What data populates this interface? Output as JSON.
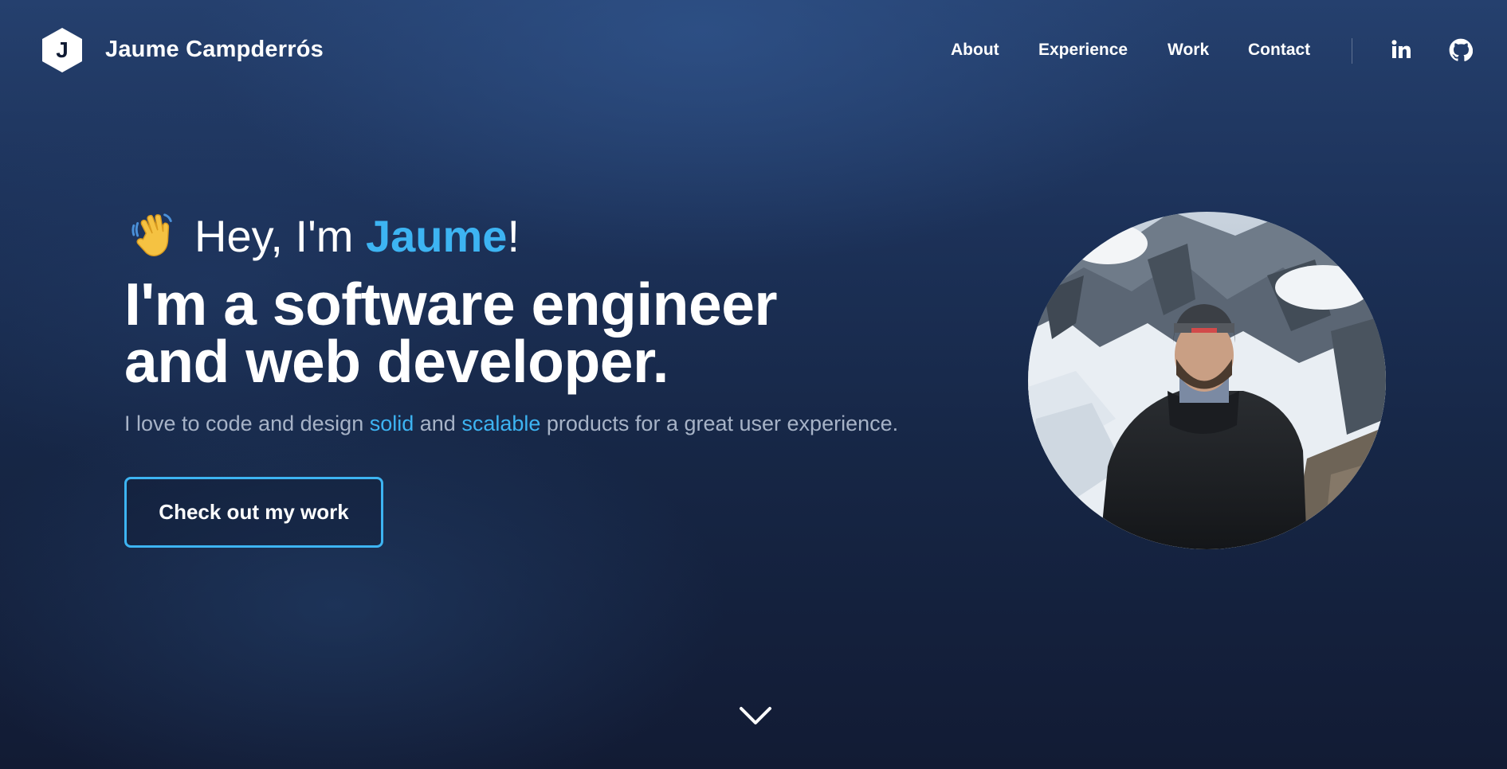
{
  "header": {
    "logo_letter": "J",
    "brand_name": "Jaume Campderrós",
    "nav": [
      {
        "label": "About"
      },
      {
        "label": "Experience"
      },
      {
        "label": "Work"
      },
      {
        "label": "Contact"
      }
    ],
    "social": [
      {
        "icon": "linkedin-icon"
      },
      {
        "icon": "github-icon"
      }
    ]
  },
  "hero": {
    "greeting_prefix": "Hey, I'm ",
    "greeting_name": "Jaume",
    "greeting_suffix": "!",
    "wave_icon": "waving-hand-icon",
    "headline_1_prefix": "I'm a ",
    "headline_1_bold": "software engineer",
    "headline_2_prefix": "and ",
    "headline_2_bold": "web developer",
    "headline_2_suffix": ".",
    "tagline_1": "I love to code and design ",
    "tagline_hl_1": "solid",
    "tagline_2": " and ",
    "tagline_hl_2": "scalable",
    "tagline_3": " products for a great user experience.",
    "cta_label": "Check out my work",
    "scroll_icon": "chevron-down-icon"
  },
  "colors": {
    "accent": "#3db4f2",
    "background_dark": "#121b34",
    "background_light": "#25406e",
    "muted_text": "#a7b3c7"
  }
}
